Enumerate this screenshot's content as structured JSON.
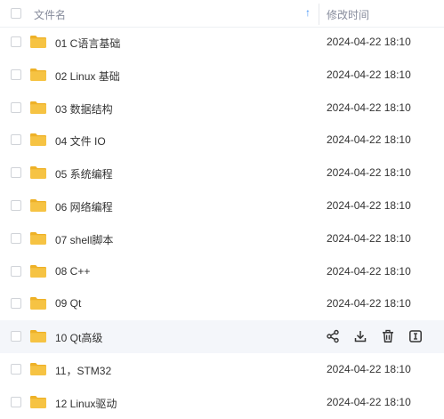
{
  "header": {
    "name_label": "文件名",
    "sort_icon": "arrow-up-icon",
    "sort_glyph": "↑",
    "time_label": "修改时间"
  },
  "colors": {
    "folder": "#f6c343",
    "folder_dark": "#eeb127",
    "accent": "#3a8ef6",
    "hover_row": "#f4f6fa"
  },
  "files": [
    {
      "name": "01 C语言基础",
      "modified": "2024-04-22 18:10"
    },
    {
      "name": "02 Linux 基础",
      "modified": "2024-04-22 18:10"
    },
    {
      "name": "03 数据结构",
      "modified": "2024-04-22 18:10"
    },
    {
      "name": "04 文件 IO",
      "modified": "2024-04-22 18:10"
    },
    {
      "name": "05 系统编程",
      "modified": "2024-04-22 18:10"
    },
    {
      "name": "06 网络编程",
      "modified": "2024-04-22 18:10"
    },
    {
      "name": "07 shell脚本",
      "modified": "2024-04-22 18:10"
    },
    {
      "name": "08 C++",
      "modified": "2024-04-22 18:10"
    },
    {
      "name": "09 Qt",
      "modified": "2024-04-22 18:10"
    },
    {
      "name": "10 Qt高级",
      "modified": "",
      "hover_actions": [
        "share-icon",
        "download-icon",
        "delete-icon",
        "rename-icon"
      ]
    },
    {
      "name": "11，STM32",
      "modified": "2024-04-22 18:10"
    },
    {
      "name": "12 Linux驱动",
      "modified": "2024-04-22 18:10"
    }
  ]
}
